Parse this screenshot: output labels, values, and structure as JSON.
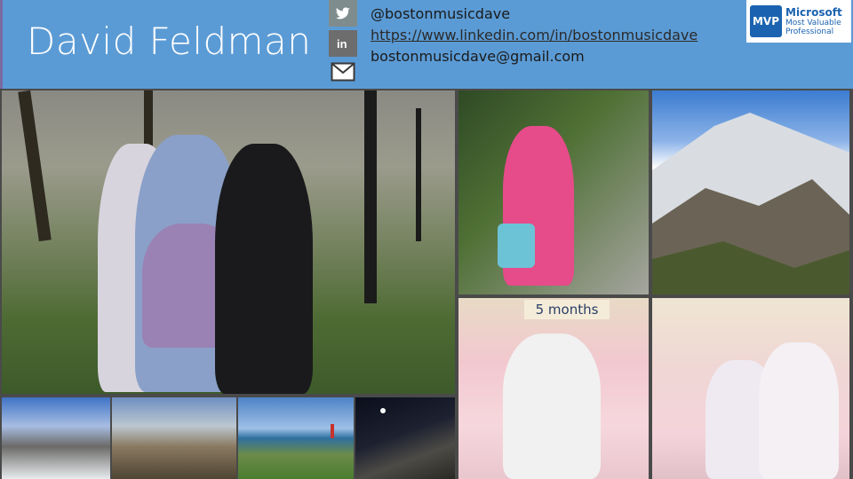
{
  "header": {
    "name": "David Feldman",
    "twitter": "@bostonmusicdave",
    "linkedin_url": "https://www.linkedin.com/in/bostonmusicdave",
    "email": "bostonmusicdave@gmail.com",
    "icons": [
      "twitter-icon",
      "linkedin-icon",
      "mail-icon"
    ],
    "mvp_badge": {
      "abbrev": "MVP",
      "line1": "Microsoft",
      "line2": "Most Valuable",
      "line3": "Professional"
    }
  },
  "photos": {
    "baby1_sign": "5 months"
  },
  "colors": {
    "header_bg": "#5b9bd5",
    "page_bg": "#4a4a4a",
    "mvp_blue": "#1b63b0"
  }
}
